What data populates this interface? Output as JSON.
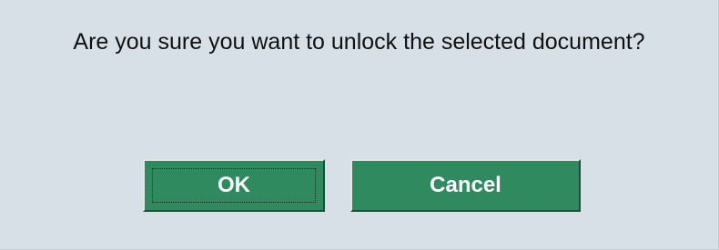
{
  "dialog": {
    "message": "Are you sure you want to unlock the selected document?",
    "ok_label": "OK",
    "cancel_label": "Cancel"
  },
  "colors": {
    "background": "#d6e0e6",
    "button": "#2f8a5f",
    "button_text": "#ffffff"
  }
}
